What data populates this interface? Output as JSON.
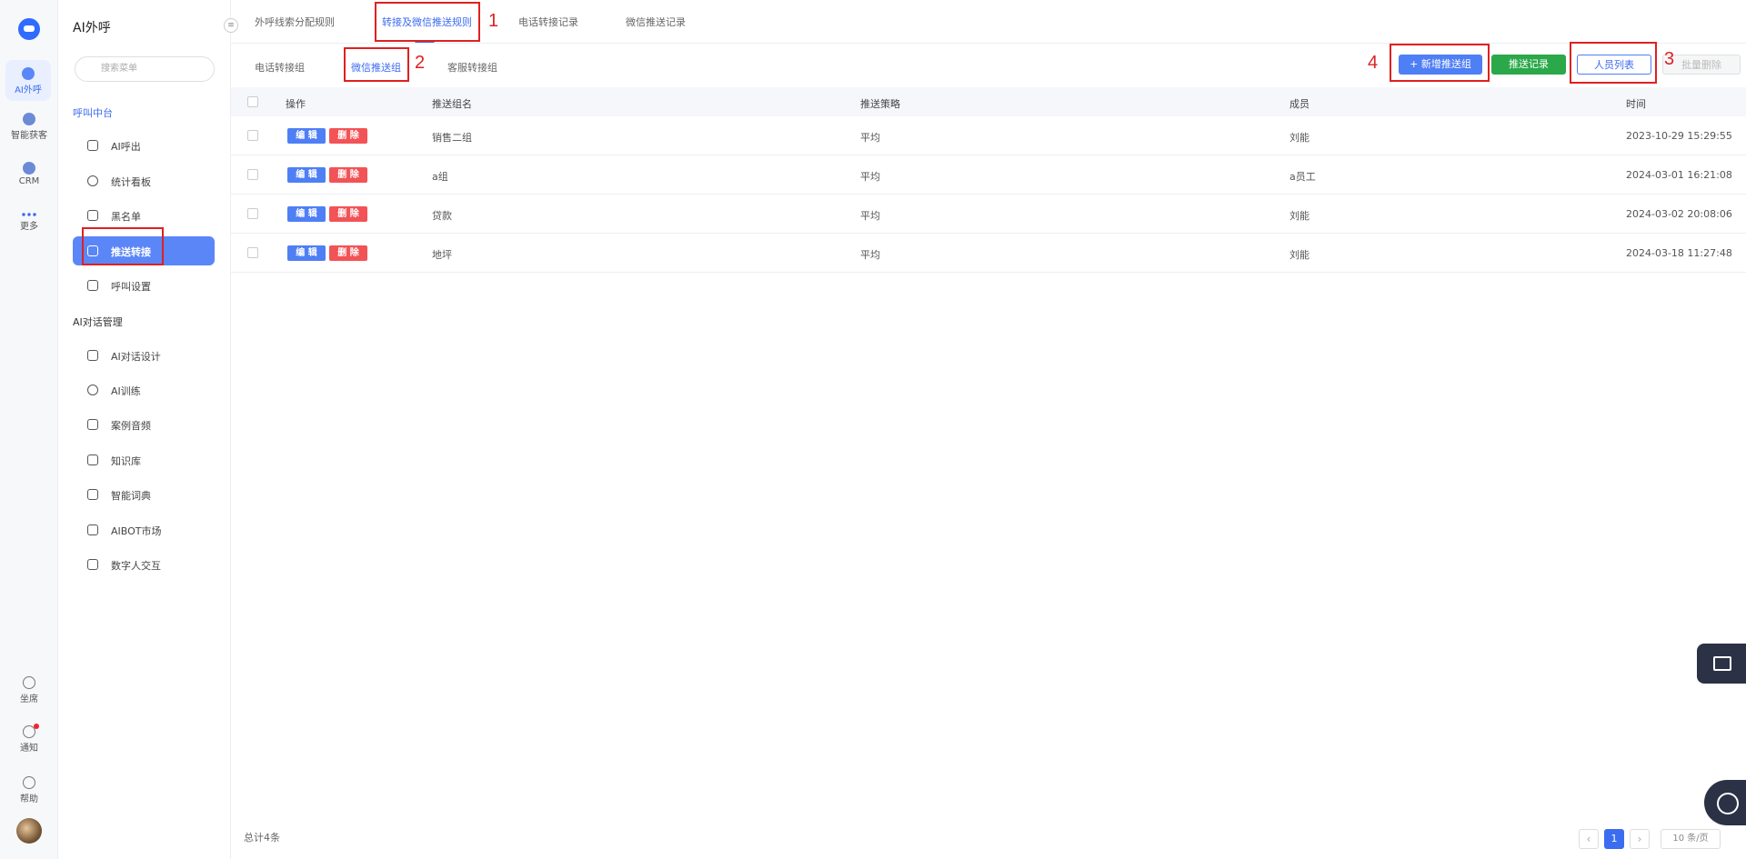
{
  "rail": {
    "items": [
      {
        "label": "AI外呼",
        "icon": "ai-call-icon"
      },
      {
        "label": "智能获客",
        "icon": "acquire-icon"
      },
      {
        "label": "CRM",
        "icon": "crm-icon"
      },
      {
        "label": "更多",
        "icon": "more-icon"
      }
    ],
    "bottom": [
      {
        "label": "坐席",
        "icon": "headset-icon"
      },
      {
        "label": "通知",
        "icon": "bell-icon"
      },
      {
        "label": "帮助",
        "icon": "help-icon"
      }
    ]
  },
  "menu": {
    "title": "AI外呼",
    "search_placeholder": "搜索菜单",
    "groups": [
      {
        "label": "呼叫中台",
        "items": [
          {
            "label": "AI呼出",
            "icon": "phone-icon"
          },
          {
            "label": "统计看板",
            "icon": "pie-chart-icon"
          },
          {
            "label": "黑名单",
            "icon": "warning-icon"
          },
          {
            "label": "推送转接",
            "icon": "send-icon"
          },
          {
            "label": "呼叫设置",
            "icon": "sliders-icon"
          }
        ]
      },
      {
        "label": "AI对话管理",
        "items": [
          {
            "label": "AI对话设计",
            "icon": "pen-icon"
          },
          {
            "label": "AI训练",
            "icon": "chat-icon"
          },
          {
            "label": "案例音频",
            "icon": "voicemail-icon"
          },
          {
            "label": "知识库",
            "icon": "laptop-icon"
          },
          {
            "label": "智能词典",
            "icon": "book-icon"
          },
          {
            "label": "AIBOT市场",
            "icon": "window-icon"
          },
          {
            "label": "数字人交互",
            "icon": "lock-icon"
          }
        ]
      }
    ]
  },
  "tabs": [
    "外呼线索分配规则",
    "转接及微信推送规则",
    "电话转接记录",
    "微信推送记录"
  ],
  "subtabs": [
    "电话转接组",
    "微信推送组",
    "客服转接组"
  ],
  "buttons": {
    "add": "+ 新增推送组",
    "log": "推送记录",
    "users": "人员列表",
    "batch_delete": "批量删除"
  },
  "annotations": [
    "1",
    "2",
    "3",
    "4"
  ],
  "table": {
    "headers": [
      "操作",
      "推送组名",
      "推送策略",
      "成员",
      "时间"
    ],
    "edit_label": "编 辑",
    "delete_label": "删 除",
    "rows": [
      {
        "name": "销售二组",
        "strategy": "平均",
        "member": "刘能",
        "time": "2023-10-29 15:29:55"
      },
      {
        "name": "a组",
        "strategy": "平均",
        "member": "a员工",
        "time": "2024-03-01 16:21:08"
      },
      {
        "name": "贷款",
        "strategy": "平均",
        "member": "刘能",
        "time": "2024-03-02 20:08:06"
      },
      {
        "name": "地坪",
        "strategy": "平均",
        "member": "刘能",
        "time": "2024-03-18 11:27:48"
      }
    ]
  },
  "footer": {
    "total": "总计4条",
    "page": "1",
    "page_size": "10 条/页"
  }
}
